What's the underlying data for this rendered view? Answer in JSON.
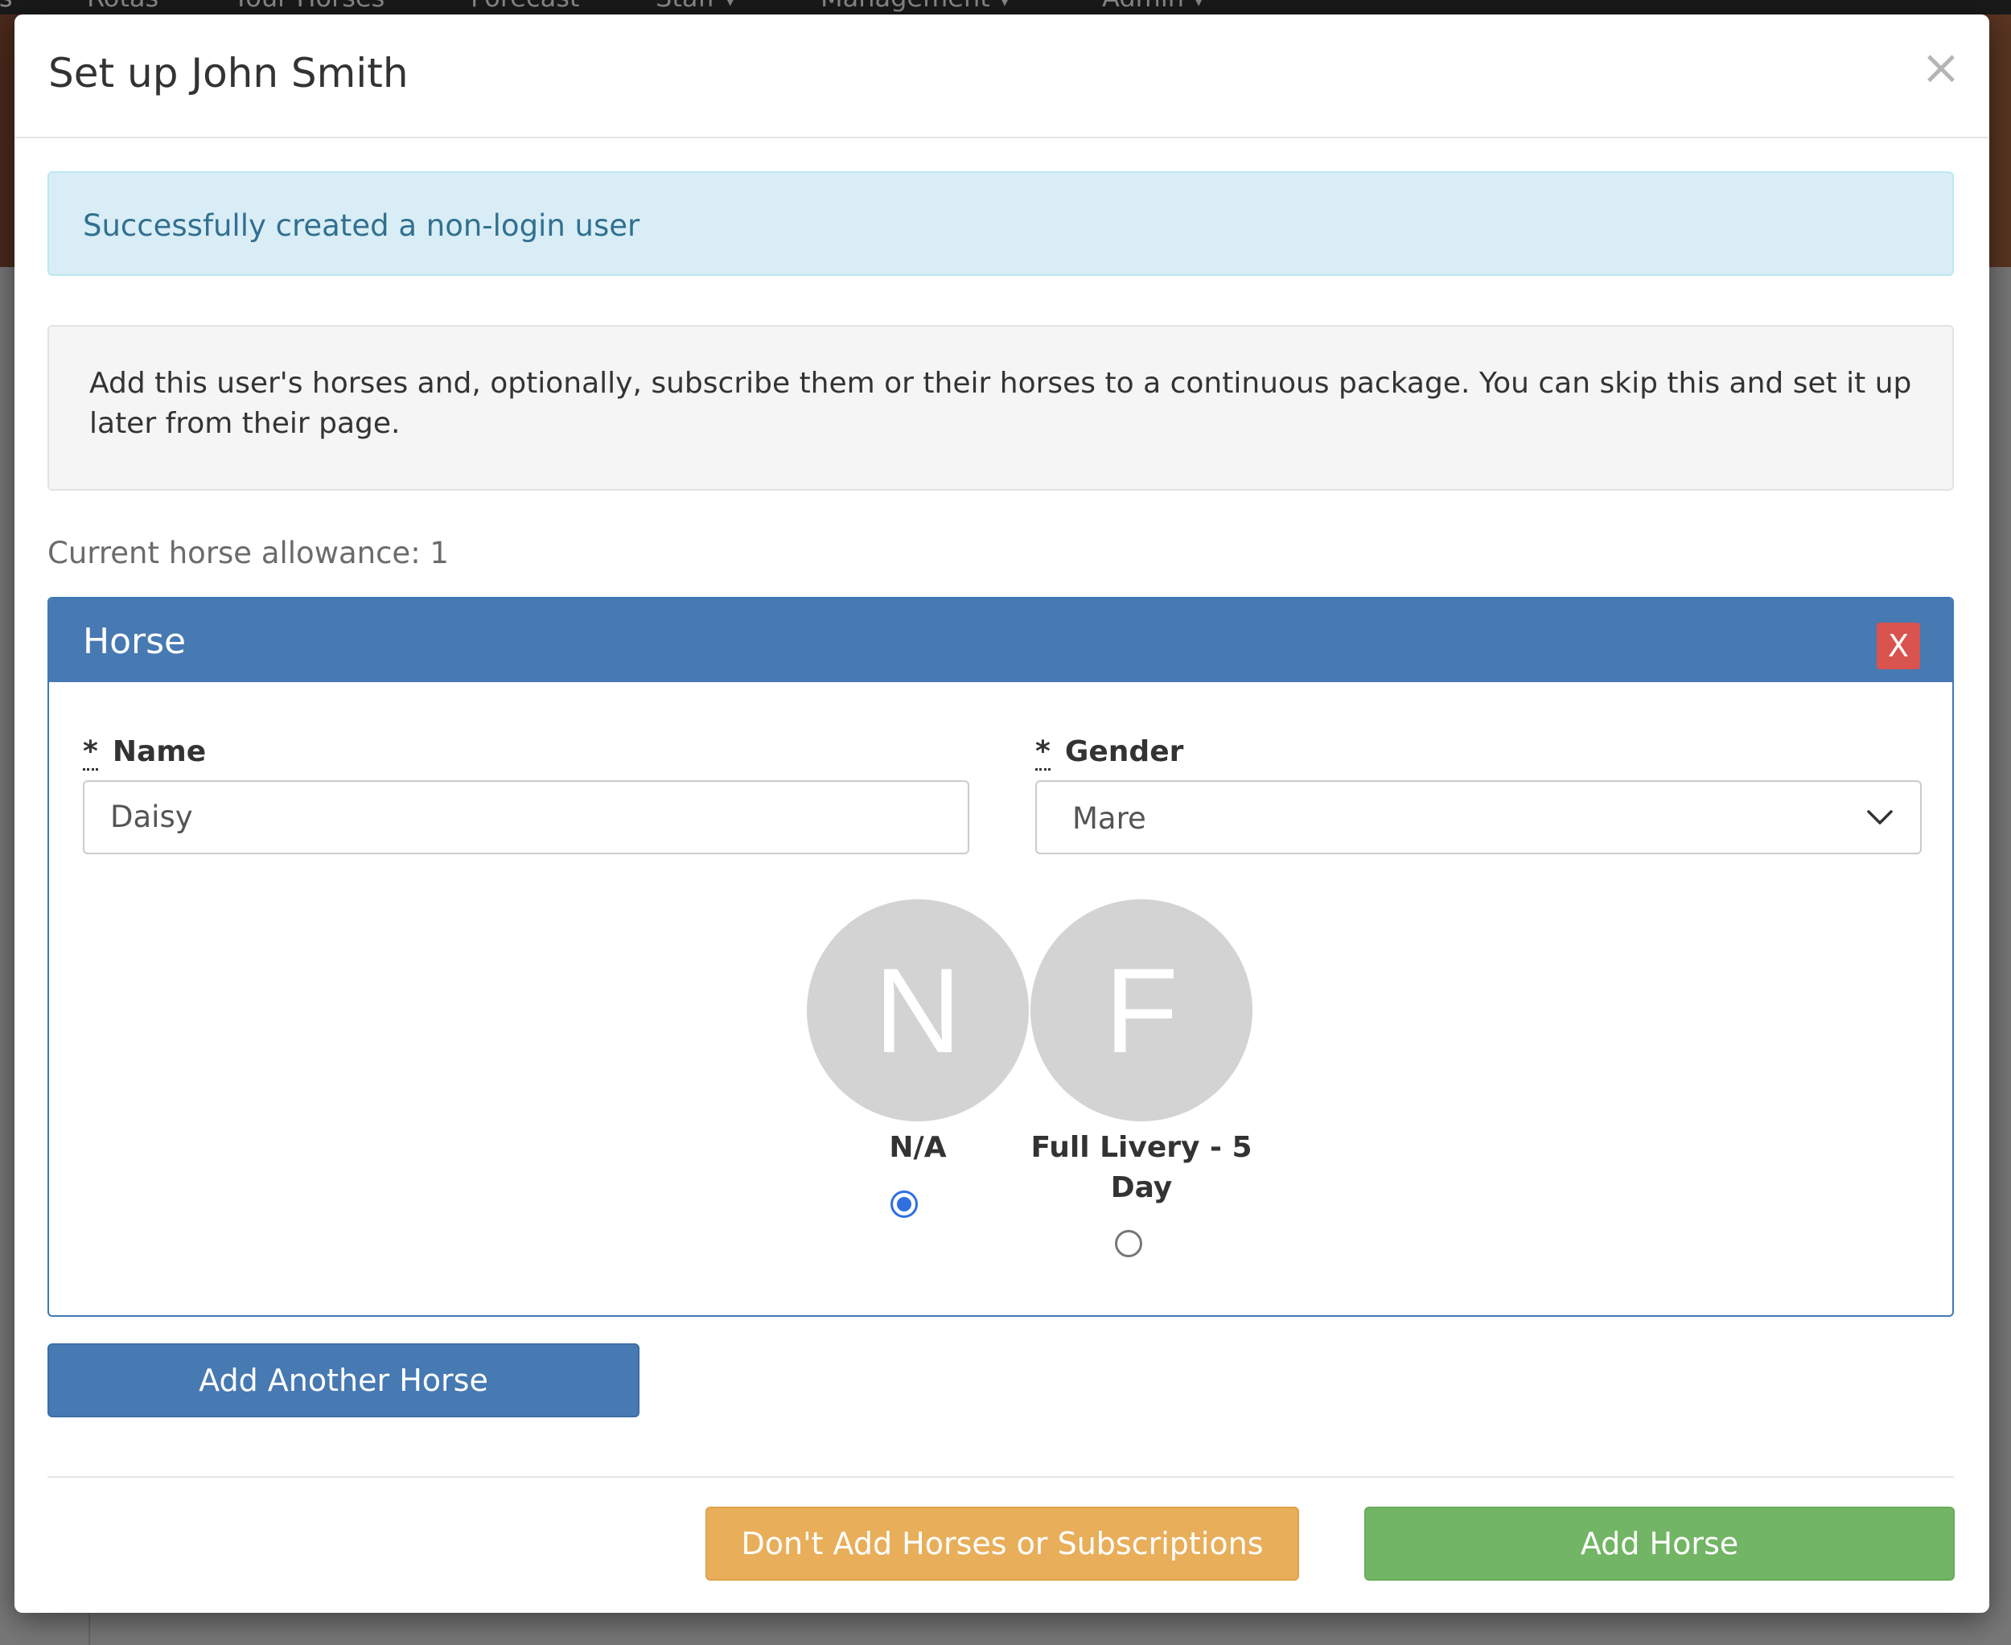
{
  "background": {
    "nav_items": [
      "ls",
      "Rotas",
      "Your Horses",
      "Forecast",
      "Staff ▾",
      "Management ▾",
      "Admin ▾"
    ]
  },
  "modal": {
    "title": "Set up John Smith",
    "close_symbol": "×",
    "alert_text": "Successfully created a non-login user",
    "info_text": "Add this user's horses and, optionally, subscribe them or their horses to a continuous package. You can skip this and set it up later from their page.",
    "allowance_text": "Current horse allowance: 1",
    "horse_panel": {
      "title": "Horse",
      "remove_label": "X",
      "name_label": "Name",
      "name_value": "Daisy",
      "gender_label": "Gender",
      "gender_value": "Mare",
      "required_marker": "*",
      "packages": [
        {
          "initial": "N",
          "label": "N/A",
          "selected": true
        },
        {
          "initial": "F",
          "label": "Full Livery - 5 Day",
          "selected": false
        }
      ]
    },
    "add_another_label": "Add Another Horse",
    "skip_label": "Don't Add Horses or Subscriptions",
    "add_horse_label": "Add Horse"
  },
  "colors": {
    "primary": "#4779b2",
    "warning": "#e8ae5a",
    "success": "#72b564",
    "danger": "#d9534f",
    "info_bg": "#d9edf7",
    "info_text": "#31708f"
  }
}
